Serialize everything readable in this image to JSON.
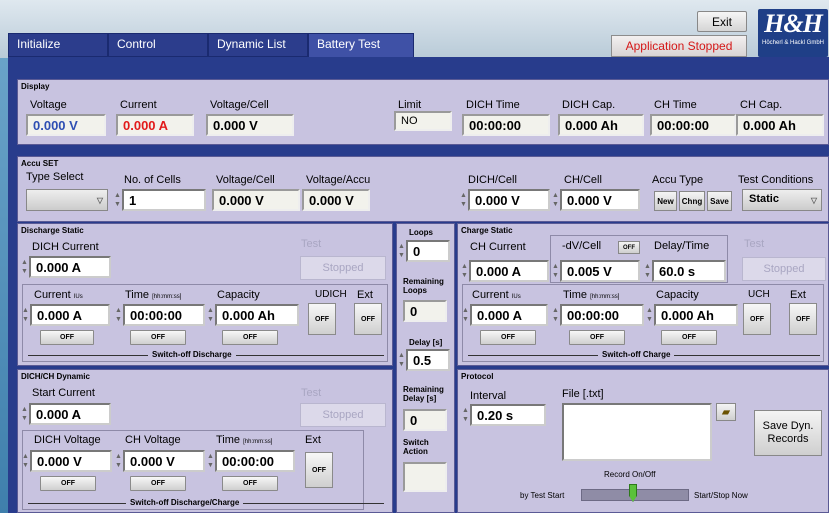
{
  "header": {
    "tabs": [
      "Initialize",
      "Control",
      "Dynamic List",
      "Battery Test"
    ],
    "active_tab": "Battery Test",
    "exit_label": "Exit",
    "status": "Application Stopped",
    "status_color": "#d51818",
    "logo_text": "H&H",
    "logo_subtext": "Höcherl & Hackl GmbH"
  },
  "display": {
    "title": "Display",
    "voltage_label": "Voltage",
    "voltage_value": "0.000 V",
    "current_label": "Current",
    "current_value": "0.000 A",
    "vcell_label": "Voltage/Cell",
    "vcell_value": "0.000 V",
    "limit_label": "Limit",
    "limit_value": "NO",
    "dich_time_label": "DICH Time",
    "dich_time_value": "00:00:00",
    "dich_cap_label": "DICH Cap.",
    "dich_cap_value": "0.000 Ah",
    "ch_time_label": "CH Time",
    "ch_time_value": "00:00:00",
    "ch_cap_label": "CH Cap.",
    "ch_cap_value": "0.000 Ah",
    "voltage_color": "#2f4fb3",
    "current_color": "#e21b1b"
  },
  "accu": {
    "title": "Accu SET",
    "type_select_label": "Type Select",
    "cells_label": "No. of Cells",
    "cells_value": "1",
    "vcell_label": "Voltage/Cell",
    "vcell_value": "0.000 V",
    "vaccu_label": "Voltage/Accu",
    "vaccu_value": "0.000 V",
    "dich_cell_label": "DICH/Cell",
    "dich_cell_value": "0.000 V",
    "ch_cell_label": "CH/Cell",
    "ch_cell_value": "0.000 V",
    "accu_type_label": "Accu Type",
    "accu_type_buttons": [
      "New",
      "Chng",
      "Save"
    ],
    "test_cond_label": "Test Conditions",
    "test_cond_value": "Static"
  },
  "discharge_static": {
    "title": "Discharge Static",
    "dich_current_label": "DICH Current",
    "dich_current_value": "0.000 A",
    "test_label": "Test",
    "test_button": "Stopped",
    "current_label": "Current",
    "current_sub": "IUs",
    "current_value": "0.000 A",
    "time_label": "Time",
    "time_sub": "[hh:mm:ss]",
    "time_value": "00:00:00",
    "capacity_label": "Capacity",
    "capacity_value": "0.000 Ah",
    "udich_label": "UDICH",
    "ext_label": "Ext",
    "off": "OFF",
    "switch_off_label": "Switch-off Discharge"
  },
  "middle": {
    "loops_label": "Loops",
    "loops_value": "0",
    "remaining_loops_label": "Remaining Loops",
    "remaining_loops_value": "0",
    "delay_label": "Delay [s]",
    "delay_value": "0.5",
    "remaining_delay_label": "Remaining Delay [s]",
    "remaining_delay_value": "0",
    "switch_action_label": "Switch Action"
  },
  "charge_static": {
    "title": "Charge Static",
    "ch_current_label": "CH Current",
    "ch_current_value": "0.000 A",
    "dv_label": "-dV/Cell",
    "dv_toggle": "OFF",
    "dv_value": "0.005 V",
    "delay_label": "Delay/Time",
    "delay_value": "60.0 s",
    "test_label": "Test",
    "test_button": "Stopped",
    "current_label": "Current",
    "current_sub": "IUs",
    "current_value": "0.000 A",
    "time_label": "Time",
    "time_sub": "[hh:mm:ss]",
    "time_value": "00:00:00",
    "capacity_label": "Capacity",
    "capacity_value": "0.000 Ah",
    "uch_label": "UCH",
    "ext_label": "Ext",
    "off": "OFF",
    "switch_off_label": "Switch-off Charge"
  },
  "dynamic": {
    "title": "DICH/CH Dynamic",
    "start_current_label": "Start Current",
    "start_current_value": "0.000 A",
    "test_label": "Test",
    "test_button": "Stopped",
    "dich_voltage_label": "DICH Voltage",
    "dich_voltage_value": "0.000 V",
    "ch_voltage_label": "CH Voltage",
    "ch_voltage_value": "0.000 V",
    "time_label": "Time",
    "time_sub": "[hh:mm:ss]",
    "time_value": "00:00:00",
    "ext_label": "Ext",
    "off": "OFF",
    "switch_off_label": "Switch-off Discharge/Charge"
  },
  "protocol": {
    "title": "Protocol",
    "interval_label": "Interval",
    "interval_value": "0.20 s",
    "file_label": "File [.txt]",
    "file_value": "",
    "save_button": "Save Dyn. Records",
    "record_label": "Record On/Off",
    "left_option": "by Test Start",
    "right_option": "Start/Stop Now"
  }
}
